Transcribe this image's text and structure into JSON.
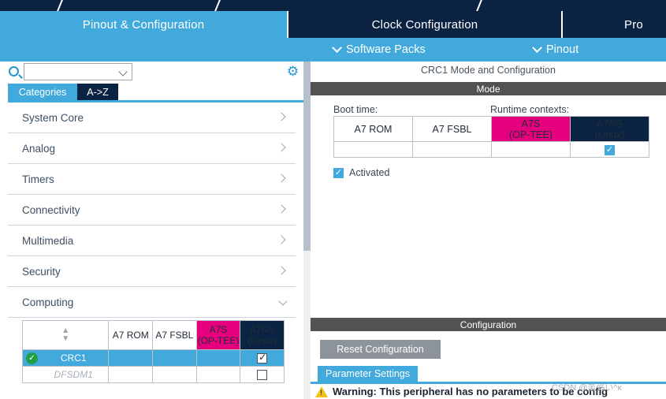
{
  "topbar": {
    "separator_icon": "diagonal-slash"
  },
  "tabs": [
    {
      "id": "pinout-config",
      "label": "Pinout & Configuration",
      "active": true
    },
    {
      "id": "clock-config",
      "label": "Clock Configuration",
      "active": false
    },
    {
      "id": "project-mgr",
      "label": "Pro",
      "active": false
    }
  ],
  "subbar": {
    "software_packs": "Software Packs",
    "pinout": "Pinout",
    "chevron_icon": "chevron-down-icon"
  },
  "sidebar": {
    "search": {
      "value": "",
      "placeholder": ""
    },
    "search_icon": "search-icon",
    "gear_icon": "gear-icon",
    "view_tabs": [
      {
        "id": "categories",
        "label": "Categories",
        "active": true
      },
      {
        "id": "az",
        "label": "A->Z",
        "active": false
      }
    ],
    "categories": [
      {
        "label": "System Core",
        "expanded": false
      },
      {
        "label": "Analog",
        "expanded": false
      },
      {
        "label": "Timers",
        "expanded": false
      },
      {
        "label": "Connectivity",
        "expanded": false
      },
      {
        "label": "Multimedia",
        "expanded": false
      },
      {
        "label": "Security",
        "expanded": false
      },
      {
        "label": "Computing",
        "expanded": true
      }
    ],
    "peripheral_table": {
      "sort_icon": "sort-updown-icon",
      "columns": [
        "A7 ROM",
        "A7 FSBL",
        "A7S\n(OP-TEE)",
        "A7NS\n(Linux)"
      ],
      "col_a7rom": "A7 ROM",
      "col_a7fsbl": "A7 FSBL",
      "col_a7s_line1": "A7S",
      "col_a7s_line2": "(OP-TEE)",
      "col_a7ns_line1": "A7NS",
      "col_a7ns_line2": "(Linux)",
      "rows": [
        {
          "name": "CRC1",
          "selected": true,
          "enabled": true,
          "checked": true,
          "status_icon": "green-check-circle-icon"
        },
        {
          "name": "DFSDM1",
          "selected": false,
          "enabled": false,
          "checked": false,
          "status_icon": ""
        }
      ]
    }
  },
  "right_panel": {
    "title": "CRC1 Mode and Configuration",
    "mode_bar": "Mode",
    "boot_time_label": "Boot time:",
    "runtime_contexts_label": "Runtime contexts:",
    "mode_table": {
      "col_a7rom": "A7 ROM",
      "col_a7fsbl": "A7 FSBL",
      "col_a7s_line1": "A7S",
      "col_a7s_line2": "(OP-TEE)",
      "col_a7ns_line1": "A7NS",
      "col_a7ns_line2": "(Linux)",
      "a7rom_checked": false,
      "a7fsbl_checked": false,
      "a7s_checked": false,
      "a7ns_checked": true
    },
    "activated_label": "Activated",
    "activated_checked": true,
    "config_bar": "Configuration",
    "reset_button": "Reset Configuration",
    "parameter_tab": "Parameter Settings",
    "warning_icon": "warning-triangle-icon",
    "warning_text": "Warning: This peripheral has no parameters to be config"
  },
  "watermark": "CSDN @苦殇い^ĸ",
  "colors": {
    "navy": "#0A2342",
    "accent_blue": "#41A9DC",
    "magenta": "#E6007E",
    "gray_bar": "#525252",
    "green_check": "#21A04A",
    "warn_yellow": "#F2C21B"
  }
}
